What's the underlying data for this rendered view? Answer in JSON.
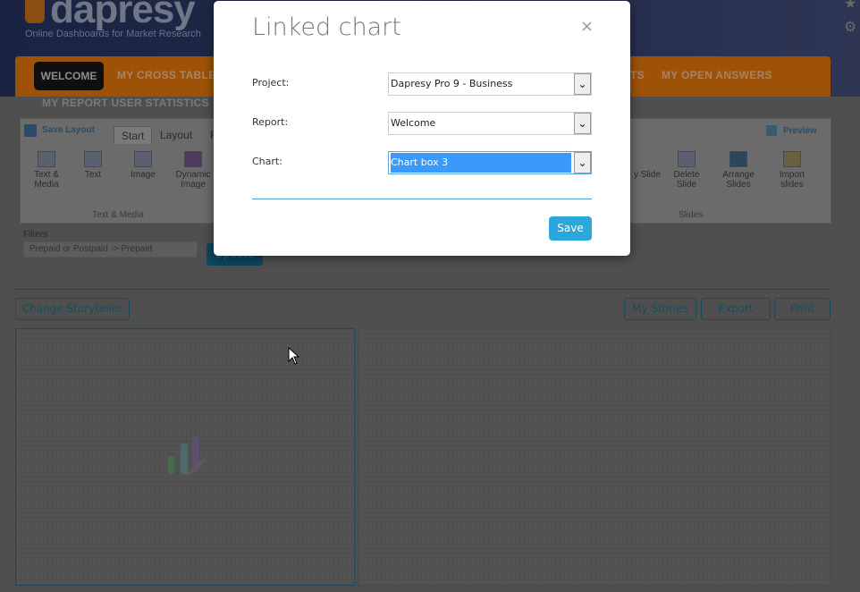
{
  "header": {
    "logo": "dapresy",
    "tagline": "Online Dashboards for Market Research"
  },
  "nav": {
    "items": [
      "WELCOME",
      "MY CROSS TABLE",
      "TS",
      "MY OPEN ANSWERS"
    ],
    "second_row": "MY REPORT USER STATISTICS"
  },
  "ribbon": {
    "save_layout": "Save Layout",
    "tabs": [
      "Start",
      "Layout",
      "F"
    ],
    "preview": "Preview",
    "left_tools": [
      {
        "label": "Text & Media",
        "icon": "text-media-icon"
      },
      {
        "label": "Text",
        "icon": "text-icon"
      },
      {
        "label": "Image",
        "icon": "image-icon"
      },
      {
        "label": "Dynamic Image",
        "icon": "dynamic-image-icon"
      }
    ],
    "right_tools": [
      {
        "label": "y Slide",
        "icon": "copy-slide-icon"
      },
      {
        "label": "Delete Slide",
        "icon": "delete-slide-icon"
      },
      {
        "label": "Arrange Slides",
        "icon": "arrange-slides-icon"
      },
      {
        "label": "Import slides",
        "icon": "import-slides-icon"
      }
    ],
    "groups": [
      "Text & Media",
      "Slides"
    ]
  },
  "filters": {
    "label": "Filters",
    "value": "Prepaid or Postpaid -> Prepaid",
    "update": "Update"
  },
  "toolbar": {
    "change_storyteller": "Change Storyteller",
    "my_stories": "My Stories",
    "export": "Export",
    "print": "Print"
  },
  "modal": {
    "title": "Linked chart",
    "close": "×",
    "fields": [
      {
        "label": "Project:",
        "value": "Dapresy Pro 9 - Business"
      },
      {
        "label": "Report:",
        "value": "Welcome"
      },
      {
        "label": "Chart:",
        "value": "Chart box 3"
      }
    ],
    "save": "Save"
  },
  "colors": {
    "accent": "#2aa8dd",
    "nav": "#f07f0a",
    "selection": "#3b99fc"
  }
}
